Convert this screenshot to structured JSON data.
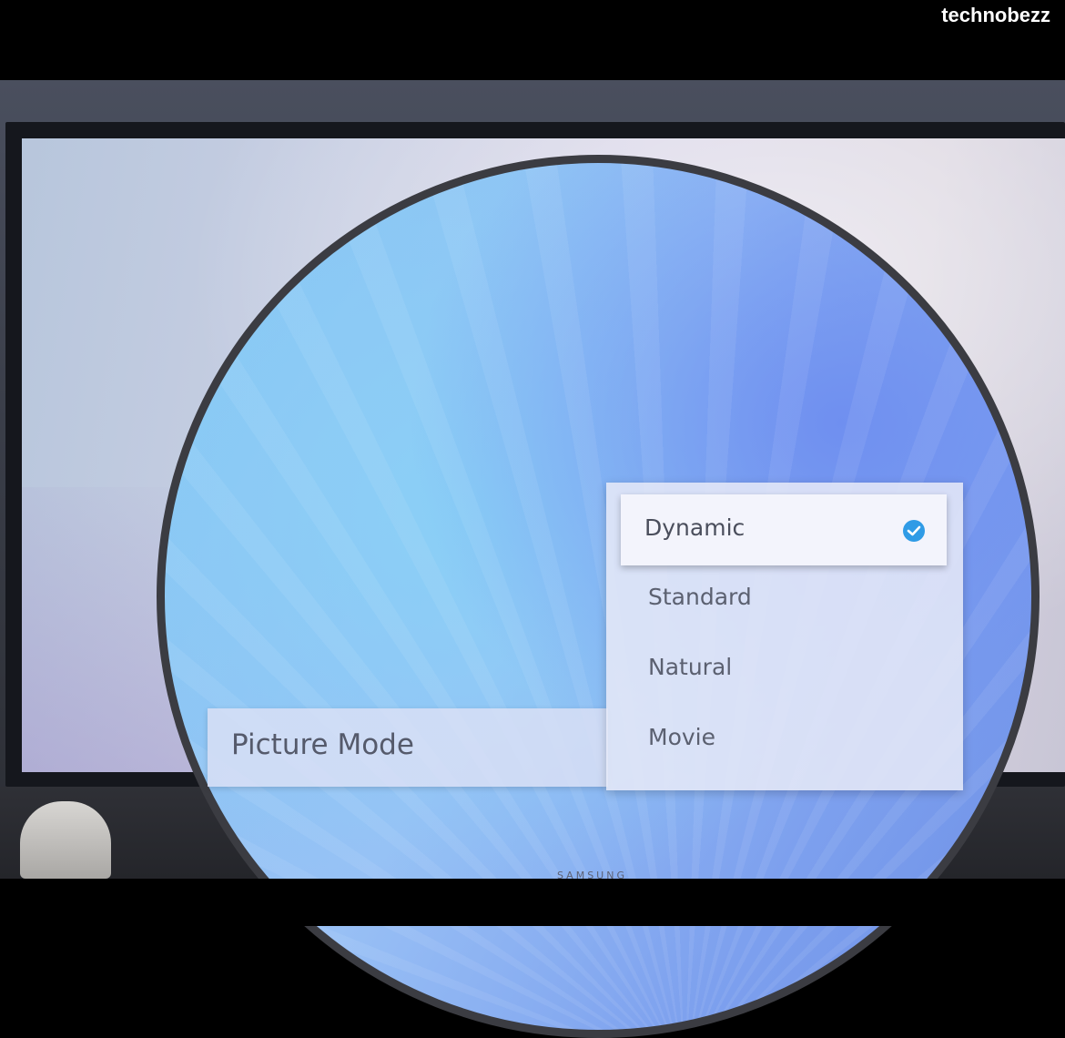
{
  "watermark": "technobezz",
  "tv": {
    "brand": "SAMSUNG"
  },
  "settings": {
    "title": "Picture Mode",
    "options": [
      {
        "label": "Dynamic",
        "selected": true
      },
      {
        "label": "Standard",
        "selected": false
      },
      {
        "label": "Natural",
        "selected": false
      },
      {
        "label": "Movie",
        "selected": false
      }
    ],
    "selected_icon": "check-circle-icon"
  },
  "colors": {
    "accent": "#2f9be6",
    "label_text": "#5b6070"
  }
}
